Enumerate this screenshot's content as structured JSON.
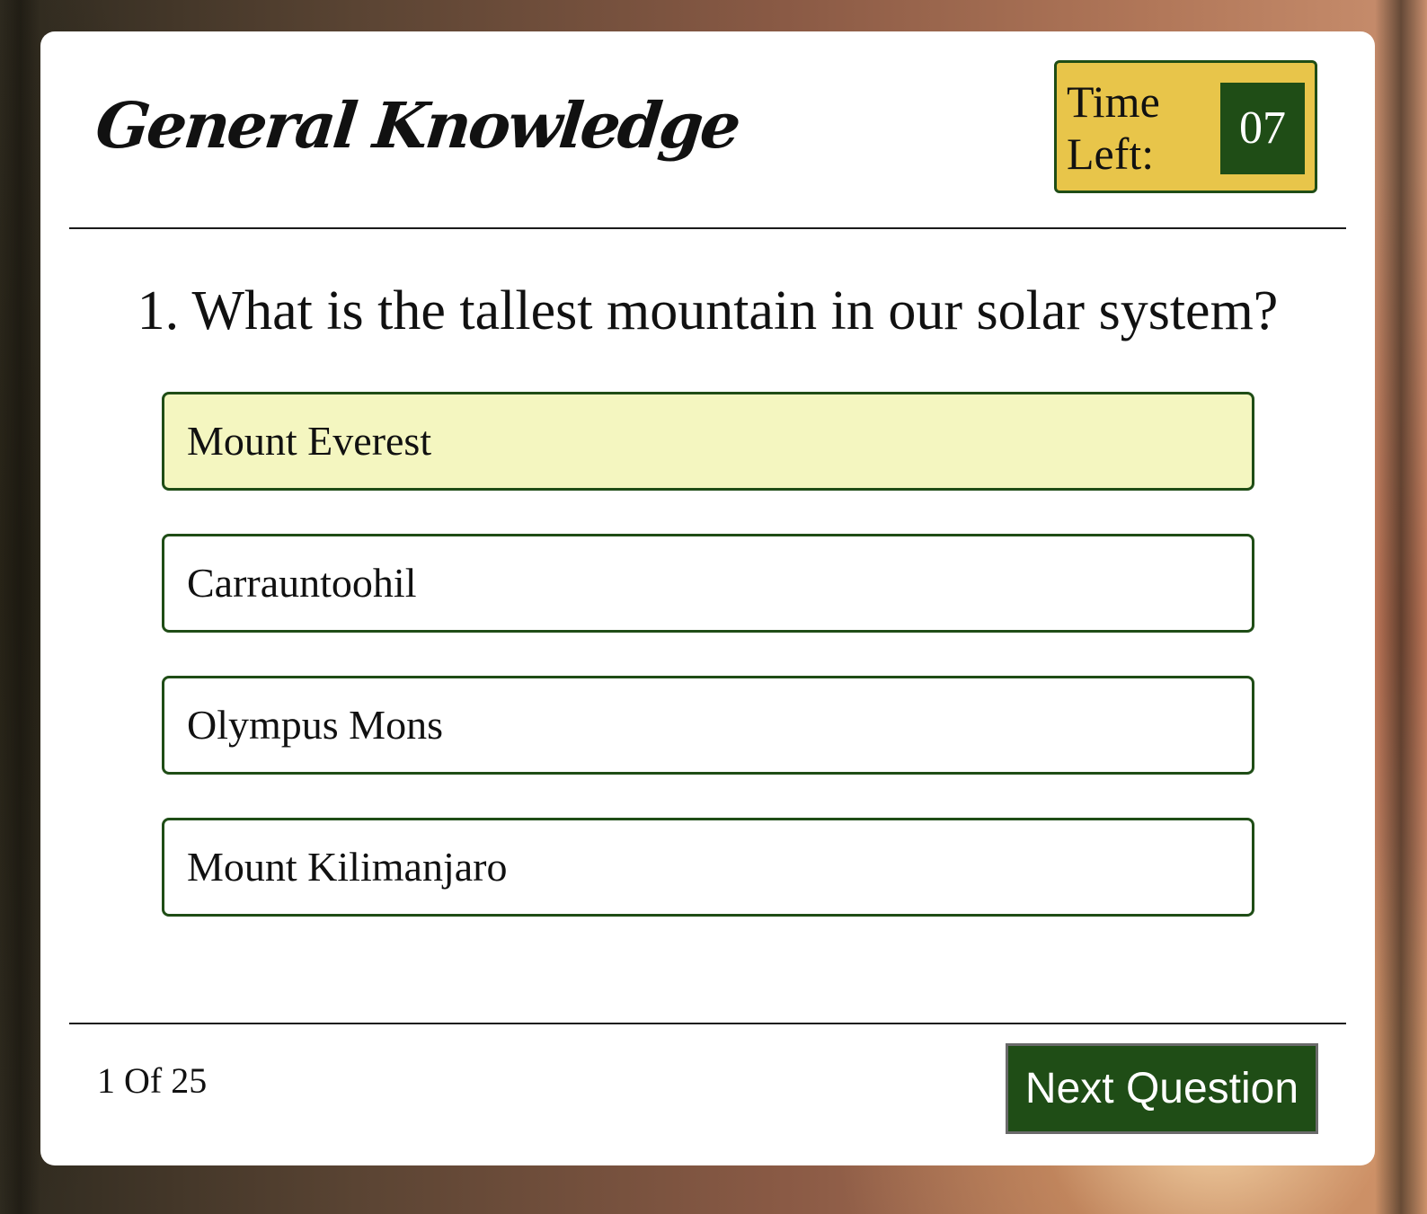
{
  "quiz": {
    "title": "General Knowledge",
    "timer": {
      "label": "Time Left:",
      "value": "07"
    },
    "question": {
      "text": "1. What is the tallest mountain in our solar system?"
    },
    "options": [
      {
        "label": "Mount Everest",
        "highlighted": true
      },
      {
        "label": "Carrauntoohil",
        "highlighted": false
      },
      {
        "label": "Olympus Mons",
        "highlighted": false
      },
      {
        "label": "Mount Kilimanjaro",
        "highlighted": false
      }
    ],
    "progress": "1 Of 25",
    "next_label": "Next Question"
  },
  "colors": {
    "accent_green": "#1f4d16",
    "timer_yellow": "#e8c54a",
    "highlight_option": "#f4f6c0"
  }
}
